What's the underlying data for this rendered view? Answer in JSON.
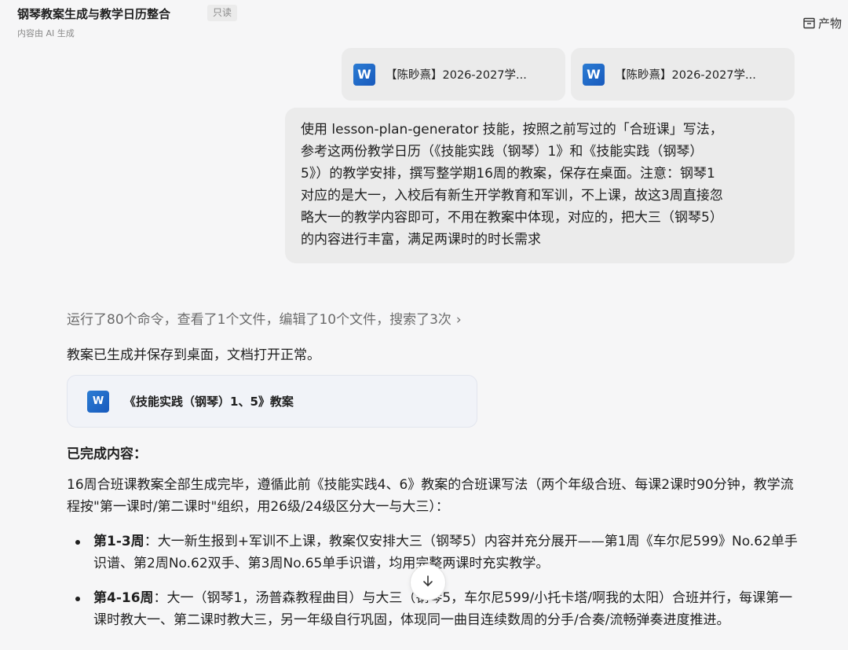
{
  "header": {
    "title": "钢琴教案生成与教学日历整合",
    "readonly_tag": "只读",
    "ai_note": "内容由 AI 生成",
    "artifacts_label": "产物"
  },
  "attachments": [
    {
      "icon": "word-icon",
      "icon_letter": "W",
      "name": "【陈眇熹】2026-2027学..."
    },
    {
      "icon": "word-icon",
      "icon_letter": "W",
      "name": "【陈眇熹】2026-2027学..."
    }
  ],
  "user_message": {
    "text": "使用 lesson-plan-generator 技能，按照之前写过的「合班课」写法，\n参考这两份教学日历（《技能实践（钢琴）1》和《技能实践（钢琴）\n5》）的教学安排，撰写整学期16周的教案，保存在桌面。注意：钢琴1\n对应的是大一，入校后有新生开学教育和军训，不上课，故这3周直接忽\n略大一的教学内容即可，不用在教案中体现，对应的，把大三（钢琴5）\n的内容进行丰富，满足两课时的时长需求"
  },
  "assistant": {
    "activity_summary": "运行了80个命令，查看了1个文件，编辑了10个文件，搜索了3次",
    "activity_chevron": "›",
    "done_text": "教案已生成并保存到桌面，文档打开正常。",
    "doc_card": {
      "icon": "word-icon",
      "icon_letter": "W",
      "name": "《技能实践（钢琴）1、5》教案"
    },
    "section_heading": "已完成内容：",
    "summary_para": "16周合班课教案全部生成完毕，遵循此前《技能实践4、6》教案的合班课写法（两个年级合班、每课2课时90分钟，教学流程按\"第一课时/第二课时\"组织，用26级/24级区分大一与大三）：",
    "bullets": [
      {
        "label": "第1-3周",
        "text": "：大一新生报到+军训不上课，教案仅安排大三（钢琴5）内容并充分展开——第1周《车尔尼599》No.62单手识谱、第2周No.62双手、第3周No.65单手识谱，均用完整两课时充实教学。"
      },
      {
        "label": "第4-16周",
        "text": "：大一（钢琴1，汤普森教程曲目）与大三（钢琴5，车尔尼599/小托卡塔/啊我的太阳）合班并行，每课第一课时教大一、第二课时教大三，另一年级自行巩固，体现同一曲目连续数周的分手/合奏/流畅弹奏进度推进。"
      }
    ],
    "scroll_down_icon": "↓"
  }
}
